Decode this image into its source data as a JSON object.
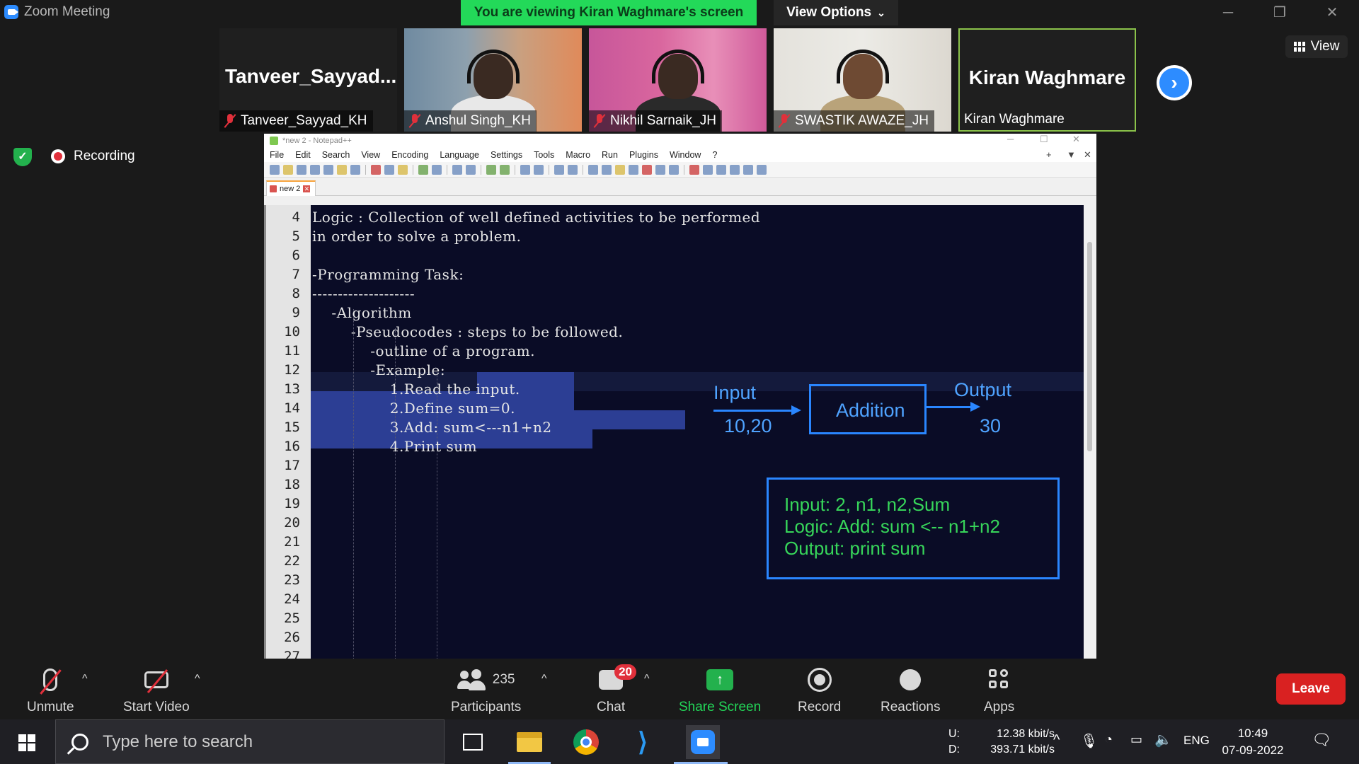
{
  "window": {
    "app_title": "Zoom Meeting",
    "viewing_banner": "You are viewing Kiran Waghmare's screen",
    "view_options_label": "View Options",
    "minimize": "─",
    "restore": "❐",
    "close": "✕"
  },
  "gallery": {
    "participants": [
      {
        "display_name": "Tanveer_Sayyad...",
        "label": "Tanveer_Sayyad_KH",
        "muted": true,
        "video": false
      },
      {
        "display_name": "",
        "label": "Anshul Singh_KH",
        "muted": true,
        "video": true
      },
      {
        "display_name": "",
        "label": "Nikhil Sarnaik_JH",
        "muted": true,
        "video": true
      },
      {
        "display_name": "",
        "label": "SWASTIK AWAZE_JH",
        "muted": true,
        "video": true
      },
      {
        "display_name": "Kiran Waghmare",
        "label": "Kiran Waghmare",
        "muted": false,
        "video": false,
        "active": true
      }
    ],
    "next_page": "›",
    "view_label": "View"
  },
  "recording": {
    "label": "Recording"
  },
  "shared_screen": {
    "window_title": "*new 2 - Notepad++",
    "menu": [
      "File",
      "Edit",
      "Search",
      "View",
      "Encoding",
      "Language",
      "Settings",
      "Tools",
      "Macro",
      "Run",
      "Plugins",
      "Window",
      "?"
    ],
    "menu_right": [
      "+",
      "▼",
      "✕"
    ],
    "tab_label": "new 2",
    "line_numbers": [
      "4",
      "5",
      "6",
      "7",
      "8",
      "9",
      "10",
      "11",
      "12",
      "13",
      "14",
      "15",
      "16",
      "17",
      "18",
      "19",
      "20",
      "21",
      "22",
      "23",
      "24",
      "25",
      "26",
      "27"
    ],
    "code_lines": [
      "Logic : Collection of well defined activities to be performed",
      "in order to solve a problem.",
      "",
      "-Programming Task:",
      "--------------------",
      "    -Algorithm",
      "        -Pseudocodes : steps to be followed.",
      "            -outline of a program.",
      "            -Example:",
      "                1.Read the input.",
      "                2.Define sum=0.",
      "                3.Add: sum<---n1+n2",
      "                4.Print sum"
    ],
    "annotation": {
      "input_label": "Input",
      "input_value": "10,20",
      "process_label": "Addition",
      "output_label": "Output",
      "output_value": "30",
      "summary_lines": [
        "Input: 2, n1, n2,Sum",
        "Logic: Add: sum <-- n1+n2",
        "Output: print sum"
      ]
    }
  },
  "controls": {
    "unmute": "Unmute",
    "start_video": "Start Video",
    "participants": "Participants",
    "participant_count": "235",
    "chat": "Chat",
    "chat_badge": "20",
    "share_screen": "Share Screen",
    "record": "Record",
    "reactions": "Reactions",
    "apps": "Apps",
    "leave": "Leave",
    "caret": "^"
  },
  "taskbar": {
    "search_placeholder": "Type here to search",
    "upload_key": "U:",
    "upload_value": "12.38 kbit/s",
    "download_key": "D:",
    "download_value": "393.71 kbit/s",
    "language": "ENG",
    "time": "10:49",
    "date": "07-09-2022"
  },
  "colors": {
    "banner_green": "#23d959",
    "leave_red": "#d92121",
    "share_green": "#23b14d",
    "zoom_blue": "#2d8cff",
    "editor_bg": "#0a0c26",
    "annotation_blue": "#2a86ff",
    "annotation_green": "#37d65a"
  }
}
